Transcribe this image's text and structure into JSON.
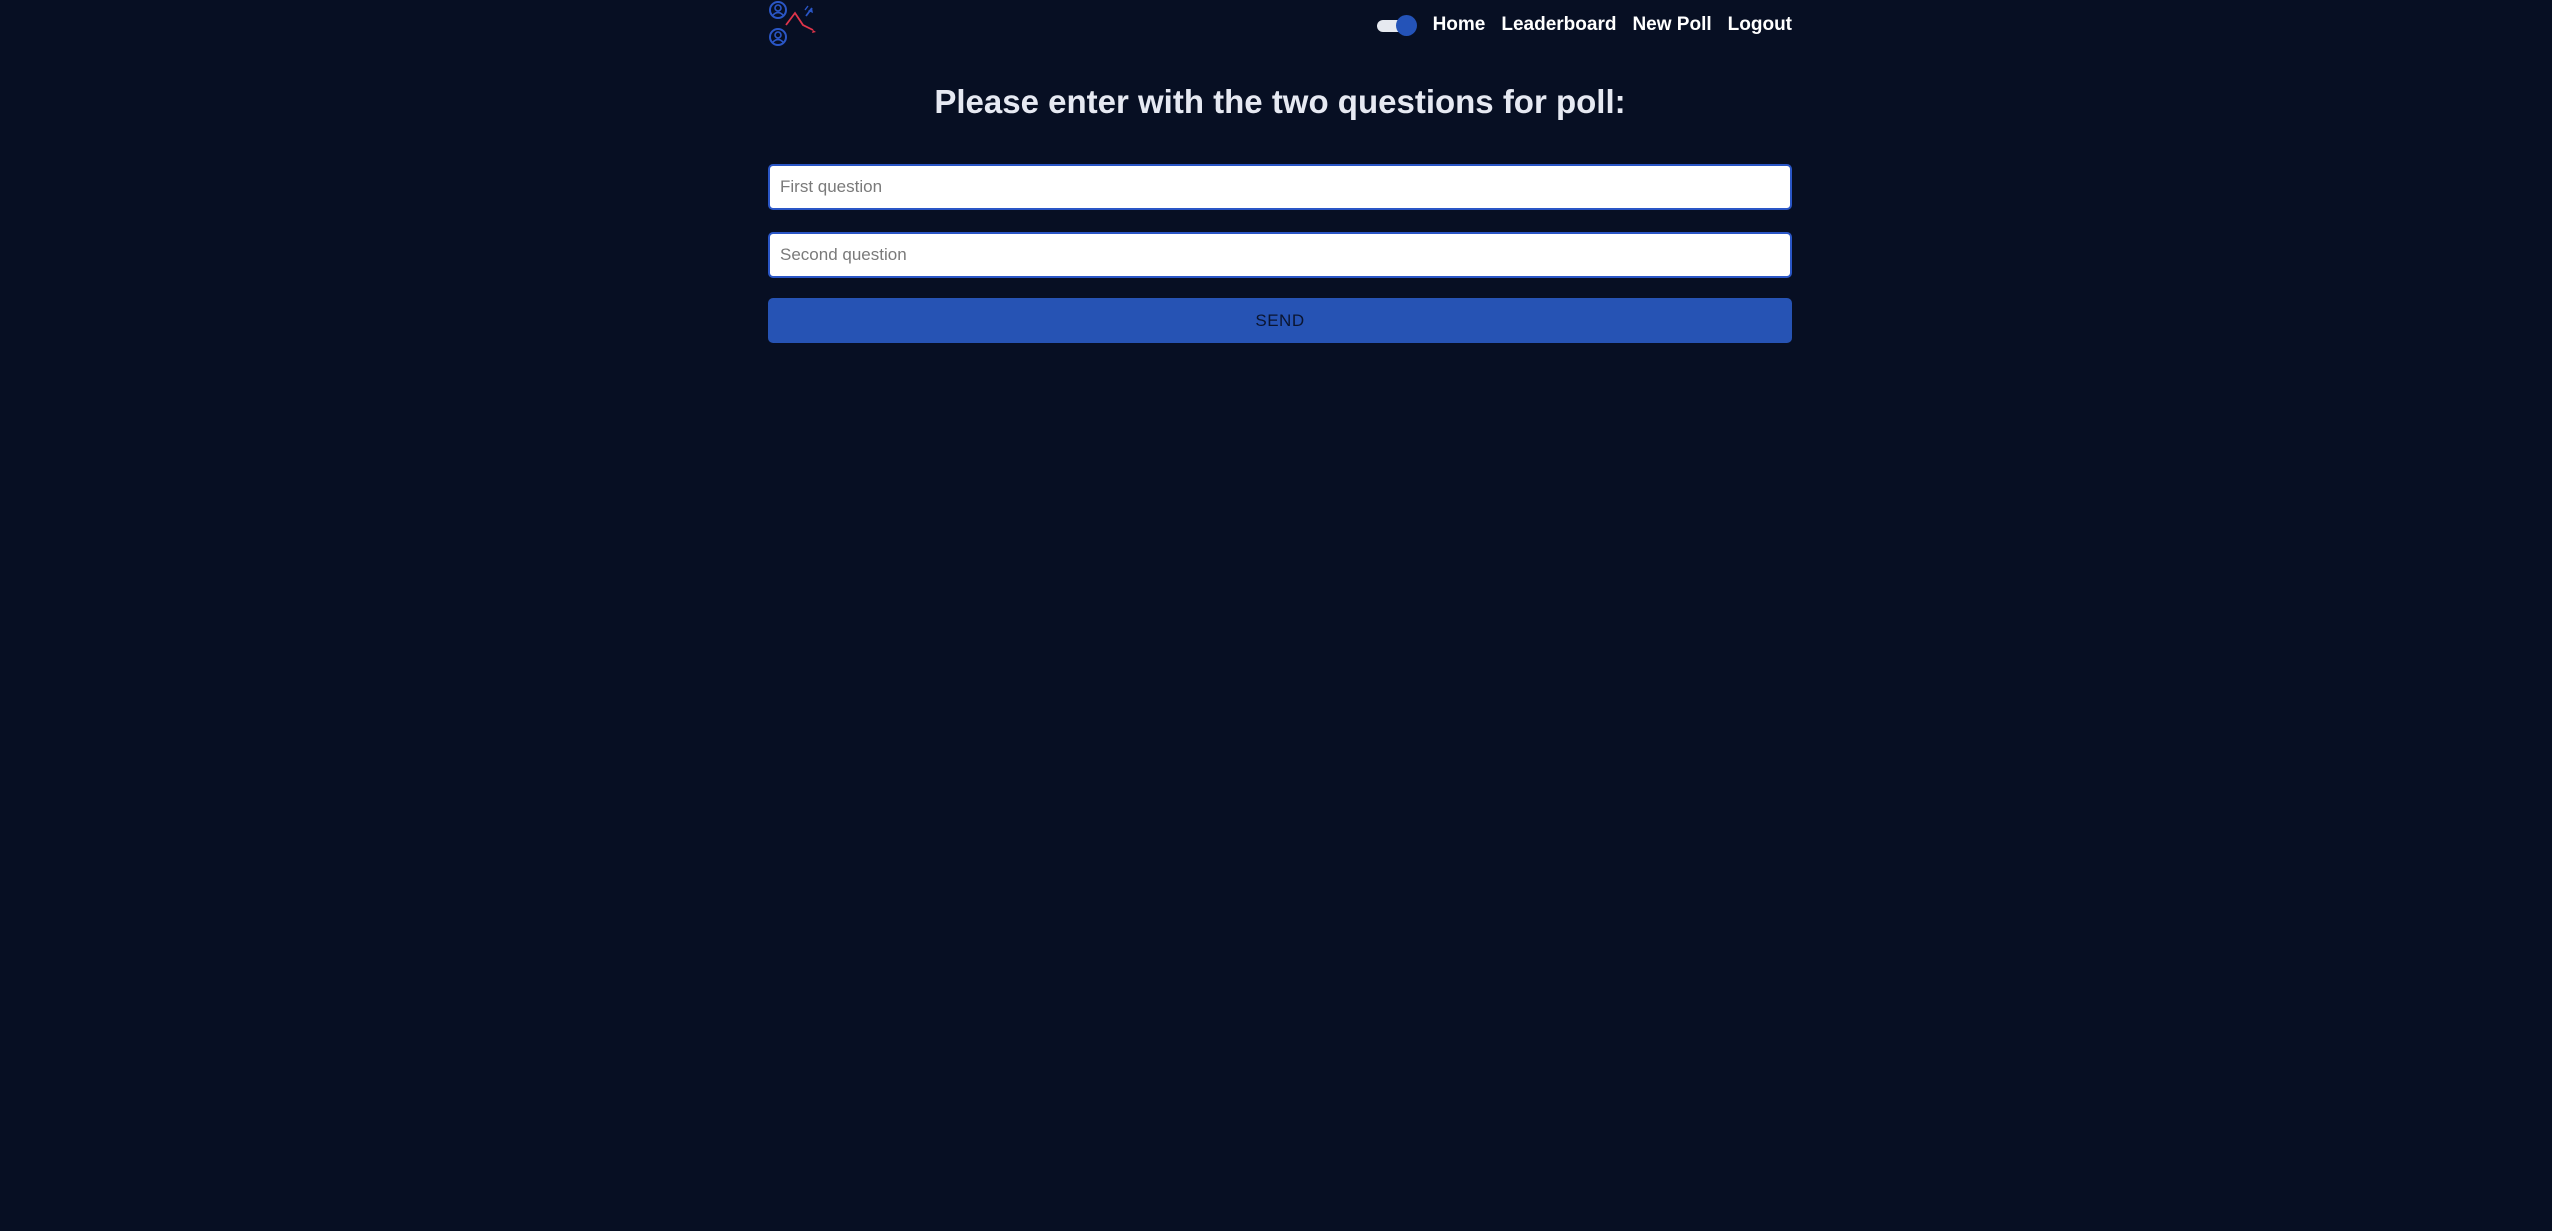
{
  "nav": {
    "logo_icon": "poll-app-logo-icon",
    "theme_toggle": {
      "icon": "toggle-switch-icon",
      "state": "on"
    },
    "links": [
      "Home",
      "Leaderboard",
      "New Poll",
      "Logout"
    ]
  },
  "form": {
    "title": "Please enter with the two questions for poll:",
    "first_question": {
      "value": "",
      "placeholder": "First question"
    },
    "second_question": {
      "value": "",
      "placeholder": "Second question"
    },
    "submit_label": "SEND"
  },
  "colors": {
    "background": "#070f23",
    "accent": "#2653b4",
    "logo_secondary": "#e0344a",
    "text": "#ffffff"
  }
}
